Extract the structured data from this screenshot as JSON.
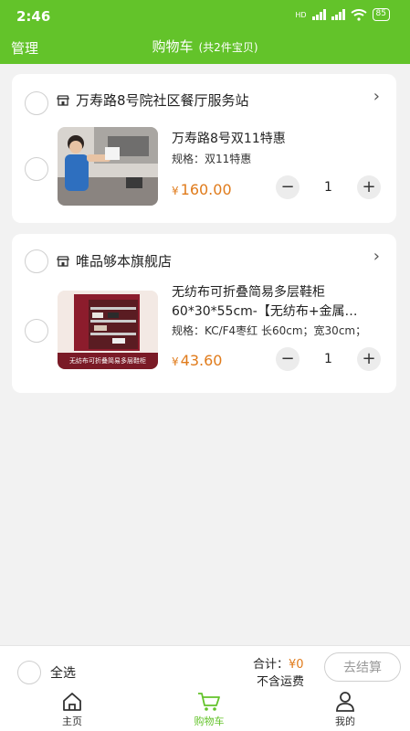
{
  "status": {
    "time": "2:46",
    "hd": "HD",
    "battery": "85"
  },
  "header": {
    "manage": "管理",
    "title": "购物车",
    "subtitle": "(共2件宝贝)"
  },
  "stores": [
    {
      "name": "万寿路8号院社区餐厅服务站",
      "item": {
        "name": "万寿路8号双11特惠",
        "spec": "规格：双11特惠",
        "currency": "¥",
        "price": "160.00",
        "qty": "1"
      }
    },
    {
      "name": "唯品够本旗舰店",
      "item": {
        "name_line1": "无纺布可折叠简易多层鞋柜",
        "name_line2": "60*30*55cm-【无纺布+金属…",
        "spec": "规格：KC/F4枣红 长60cm；宽30cm；",
        "image_caption": "无纺布可折叠简易多层鞋柜",
        "currency": "¥",
        "price": "43.60",
        "qty": "1"
      }
    }
  ],
  "footer": {
    "select_all": "全选",
    "total_label": "合计：",
    "total_value": "¥0",
    "shipping": "不含运费",
    "checkout": "去结算"
  },
  "nav": [
    {
      "label": "主页",
      "icon": "home-icon"
    },
    {
      "label": "购物车",
      "icon": "cart-icon"
    },
    {
      "label": "我的",
      "icon": "user-icon"
    }
  ],
  "colors": {
    "brand": "#63c32a",
    "price": "#e07b1b"
  }
}
